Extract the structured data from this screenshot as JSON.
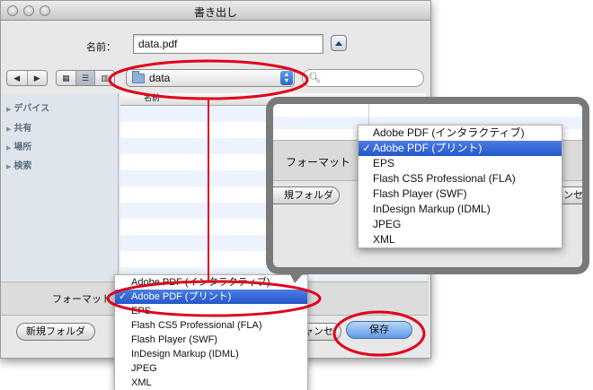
{
  "window": {
    "title": "書き出し"
  },
  "save_as": {
    "label": "名前：",
    "value": "data.pdf"
  },
  "toolbar": {
    "back_label": "◀",
    "forward_label": "▶",
    "view_icon_label": "▦",
    "view_list_label": "☰",
    "view_column_label": "▥",
    "location": "data"
  },
  "sidebar": {
    "items": [
      {
        "label": "デバイス"
      },
      {
        "label": "共有"
      },
      {
        "label": "場所"
      },
      {
        "label": "検索"
      }
    ]
  },
  "file_list": {
    "column_name": "名前"
  },
  "format": {
    "label": "フォーマット",
    "selected": "Adobe PDF (プリント)",
    "options": [
      "Adobe PDF (インタラクティブ)",
      "Adobe PDF (プリント)",
      "EPS",
      "Flash CS5 Professional (FLA)",
      "Flash Player (SWF)",
      "InDesign Markup (IDML)",
      "JPEG",
      "XML"
    ]
  },
  "buttons": {
    "new_folder": "新規フォルダ",
    "cancel": "キャンセル",
    "save": "保存"
  },
  "callout": {
    "format_label": "フォーマット",
    "new_folder_partial": "規フォルダ",
    "cancel_partial": "キャンセル"
  },
  "colors": {
    "annotation_red": "#e0001b",
    "selection_blue": "#2f63d0",
    "callout_gray": "#7a7a7a"
  }
}
